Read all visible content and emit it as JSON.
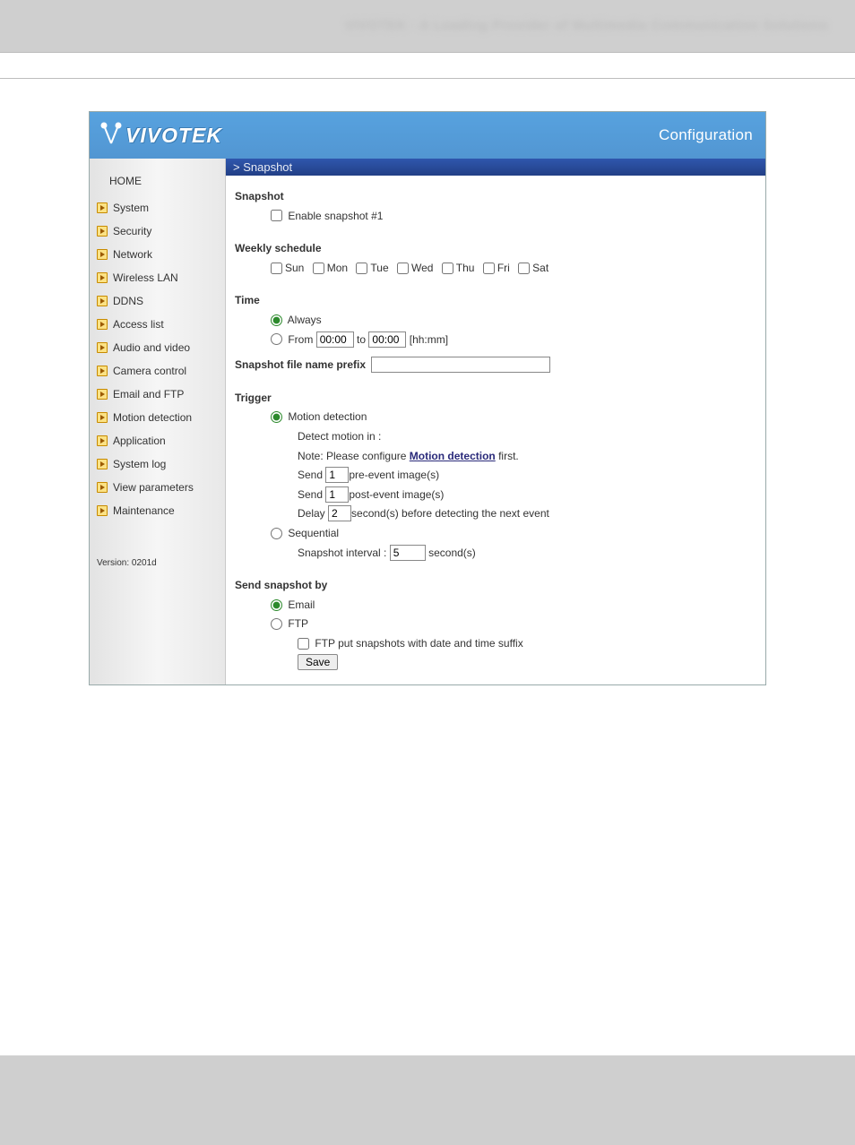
{
  "page_header": "VIVOTEK - A Leading Provider of Multimedia Communication Solutions",
  "brand": "VIVOTEK",
  "config_link": "Configuration",
  "breadcrumb": "> Snapshot",
  "sidebar": {
    "home": "HOME",
    "items": [
      "System",
      "Security",
      "Network",
      "Wireless LAN",
      "DDNS",
      "Access list",
      "Audio and video",
      "Camera control",
      "Email and FTP",
      "Motion detection",
      "Application",
      "System log",
      "View parameters",
      "Maintenance"
    ],
    "version": "Version: 0201d"
  },
  "snapshot": {
    "heading": "Snapshot",
    "enable_label": "Enable snapshot #1"
  },
  "schedule": {
    "heading": "Weekly schedule",
    "days": [
      "Sun",
      "Mon",
      "Tue",
      "Wed",
      "Thu",
      "Fri",
      "Sat"
    ]
  },
  "time": {
    "heading": "Time",
    "always": "Always",
    "from": "From",
    "to": "to",
    "from_val": "00:00",
    "to_val": "00:00",
    "hint": "[hh:mm]"
  },
  "prefix": {
    "label": "Snapshot file name prefix",
    "value": ""
  },
  "trigger": {
    "heading": "Trigger",
    "motion": "Motion detection",
    "detect_in": "Detect motion in :",
    "note_pre": "Note: Please configure ",
    "note_link": "Motion detection",
    "note_post": " first.",
    "send_pre_a": "Send ",
    "pre_val": "1",
    "send_pre_b": "pre-event image(s)",
    "send_post_a": "Send ",
    "post_val": "1",
    "send_post_b": "post-event image(s)",
    "delay_a": "Delay ",
    "delay_val": "2",
    "delay_b": "second(s) before detecting the next event",
    "sequential": "Sequential",
    "interval_a": "Snapshot interval :",
    "interval_val": "5",
    "interval_b": "second(s)"
  },
  "send": {
    "heading": "Send snapshot by",
    "email": "Email",
    "ftp": "FTP",
    "ftp_suffix": "FTP put snapshots with date and time suffix",
    "save": "Save"
  }
}
